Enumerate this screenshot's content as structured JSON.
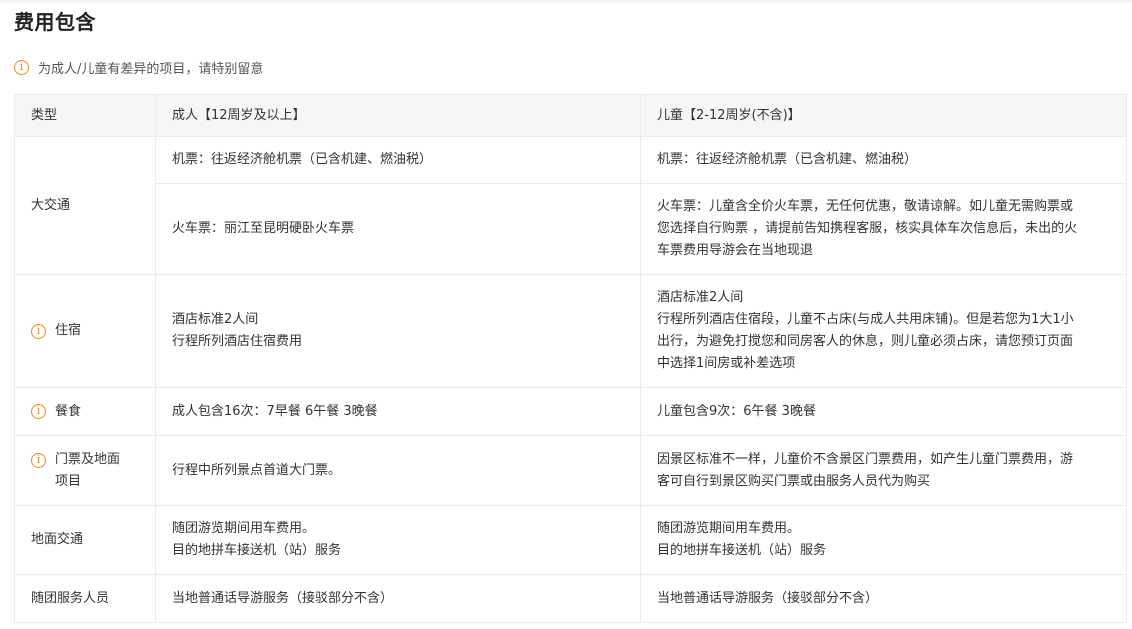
{
  "section": {
    "title": "费用包含",
    "notice": "为成人/儿童有差异的项目，请特别留意",
    "notice_icon": "warning-circle-icon",
    "accent_color": "#f08a24"
  },
  "table": {
    "headers": [
      "类型",
      "成人【12周岁及以上】",
      "儿童【2-12周岁(不含)】"
    ],
    "rows": {
      "traffic": {
        "category": "大交通",
        "flight": {
          "adult": "机票：往返经济舱机票（已含机建、燃油税）",
          "child": "机票：往返经济舱机票（已含机建、燃油税）"
        },
        "train": {
          "adult": "火车票：丽江至昆明硬卧火车票",
          "child": "火车票：儿童含全价火车票，无任何优惠，敬请谅解。如儿童无需购票或\n您选择自行购票 ，请提前告知携程客服，核实具体车次信息后，未出的火\n车票费用导游会在当地现退"
        }
      },
      "hotel": {
        "category": "住宿",
        "adult": "酒店标准2人间\n行程所列酒店住宿费用",
        "child": "酒店标准2人间\n行程所列酒店住宿段，儿童不占床(与成人共用床铺)。但是若您为1大1小\n出行，为避免打搅您和同房客人的休息，则儿童必须占床，请您预订页面\n中选择1间房或补差选项"
      },
      "meal": {
        "category": "餐食",
        "adult": "成人包含16次：7早餐 6午餐 3晚餐",
        "child": "儿童包含9次：6午餐 3晚餐"
      },
      "ticket": {
        "category": "门票及地面\n项目",
        "adult": "行程中所列景点首道大门票。",
        "child": "因景区标准不一样，儿童价不含景区门票费用，如产生儿童门票费用，游\n客可自行到景区购买门票或由服务人员代为购买"
      },
      "ground": {
        "category": "地面交通",
        "adult": "随团游览期间用车费用。\n目的地拼车接送机（站）服务",
        "child": "随团游览期间用车费用。\n目的地拼车接送机（站）服务"
      },
      "staff": {
        "category": "随团服务人员",
        "adult": "当地普通话导游服务（接驳部分不含）",
        "child": "当地普通话导游服务（接驳部分不含）"
      }
    }
  }
}
